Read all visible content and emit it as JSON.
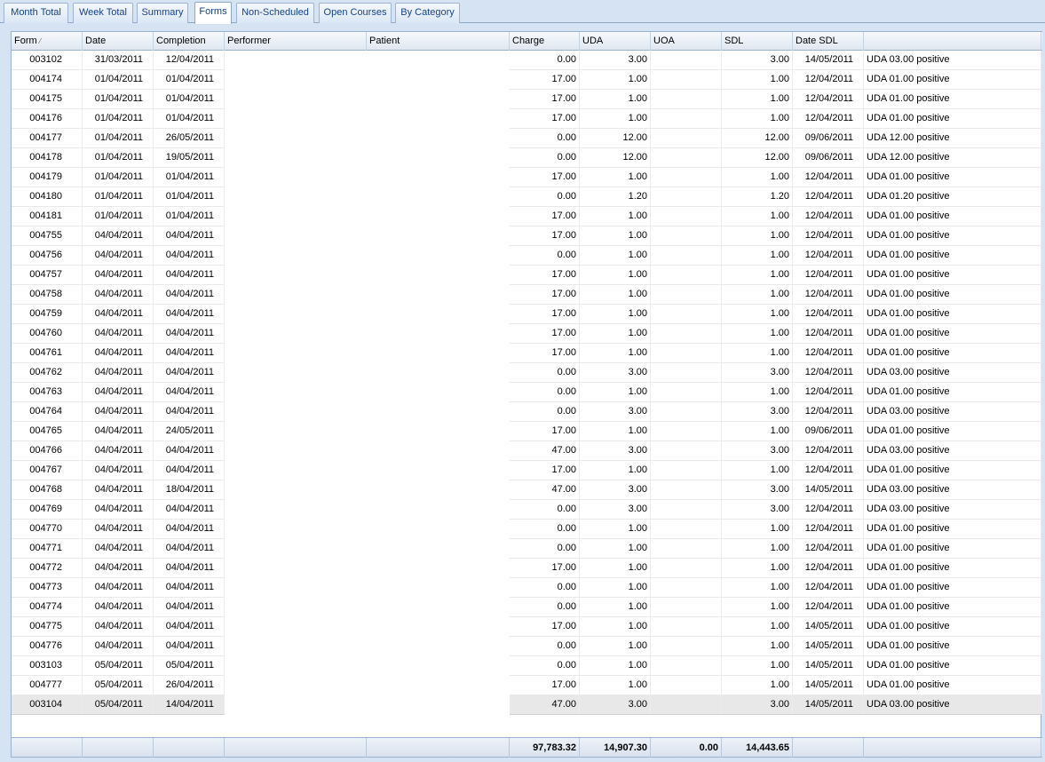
{
  "tabs": [
    {
      "label": "Month Total",
      "active": false
    },
    {
      "label": "Week Total",
      "active": false
    },
    {
      "label": "Summary",
      "active": false
    },
    {
      "label": "Forms",
      "active": true
    },
    {
      "label": "Non-Scheduled",
      "active": false
    },
    {
      "label": "Open Courses",
      "active": false
    },
    {
      "label": "By Category",
      "active": false
    }
  ],
  "columns": [
    "Form",
    "Date",
    "Completion",
    "Performer",
    "Patient",
    "Charge",
    "UDA",
    "UOA",
    "SDL",
    "Date SDL",
    ""
  ],
  "sort_indicator": "⁄",
  "rows": [
    [
      "003102",
      "31/03/2011",
      "12/04/2011",
      "",
      "",
      "0.00",
      "3.00",
      "",
      "3.00",
      "14/05/2011",
      "UDA 03.00 positive"
    ],
    [
      "004174",
      "01/04/2011",
      "01/04/2011",
      "",
      "",
      "17.00",
      "1.00",
      "",
      "1.00",
      "12/04/2011",
      "UDA 01.00 positive"
    ],
    [
      "004175",
      "01/04/2011",
      "01/04/2011",
      "",
      "",
      "17.00",
      "1.00",
      "",
      "1.00",
      "12/04/2011",
      "UDA 01.00 positive"
    ],
    [
      "004176",
      "01/04/2011",
      "01/04/2011",
      "",
      "",
      "17.00",
      "1.00",
      "",
      "1.00",
      "12/04/2011",
      "UDA 01.00 positive"
    ],
    [
      "004177",
      "01/04/2011",
      "26/05/2011",
      "",
      "",
      "0.00",
      "12.00",
      "",
      "12.00",
      "09/06/2011",
      "UDA 12.00 positive"
    ],
    [
      "004178",
      "01/04/2011",
      "19/05/2011",
      "",
      "",
      "0.00",
      "12.00",
      "",
      "12.00",
      "09/06/2011",
      "UDA 12.00 positive"
    ],
    [
      "004179",
      "01/04/2011",
      "01/04/2011",
      "",
      "",
      "17.00",
      "1.00",
      "",
      "1.00",
      "12/04/2011",
      "UDA 01.00 positive"
    ],
    [
      "004180",
      "01/04/2011",
      "01/04/2011",
      "",
      "",
      "0.00",
      "1.20",
      "",
      "1.20",
      "12/04/2011",
      "UDA 01.20 positive"
    ],
    [
      "004181",
      "01/04/2011",
      "01/04/2011",
      "",
      "",
      "17.00",
      "1.00",
      "",
      "1.00",
      "12/04/2011",
      "UDA 01.00 positive"
    ],
    [
      "004755",
      "04/04/2011",
      "04/04/2011",
      "",
      "",
      "17.00",
      "1.00",
      "",
      "1.00",
      "12/04/2011",
      "UDA 01.00 positive"
    ],
    [
      "004756",
      "04/04/2011",
      "04/04/2011",
      "",
      "",
      "0.00",
      "1.00",
      "",
      "1.00",
      "12/04/2011",
      "UDA 01.00 positive"
    ],
    [
      "004757",
      "04/04/2011",
      "04/04/2011",
      "",
      "",
      "17.00",
      "1.00",
      "",
      "1.00",
      "12/04/2011",
      "UDA 01.00 positive"
    ],
    [
      "004758",
      "04/04/2011",
      "04/04/2011",
      "",
      "",
      "17.00",
      "1.00",
      "",
      "1.00",
      "12/04/2011",
      "UDA 01.00 positive"
    ],
    [
      "004759",
      "04/04/2011",
      "04/04/2011",
      "",
      "",
      "17.00",
      "1.00",
      "",
      "1.00",
      "12/04/2011",
      "UDA 01.00 positive"
    ],
    [
      "004760",
      "04/04/2011",
      "04/04/2011",
      "",
      "",
      "17.00",
      "1.00",
      "",
      "1.00",
      "12/04/2011",
      "UDA 01.00 positive"
    ],
    [
      "004761",
      "04/04/2011",
      "04/04/2011",
      "",
      "",
      "17.00",
      "1.00",
      "",
      "1.00",
      "12/04/2011",
      "UDA 01.00 positive"
    ],
    [
      "004762",
      "04/04/2011",
      "04/04/2011",
      "",
      "",
      "0.00",
      "3.00",
      "",
      "3.00",
      "12/04/2011",
      "UDA 03.00 positive"
    ],
    [
      "004763",
      "04/04/2011",
      "04/04/2011",
      "",
      "",
      "0.00",
      "1.00",
      "",
      "1.00",
      "12/04/2011",
      "UDA 01.00 positive"
    ],
    [
      "004764",
      "04/04/2011",
      "04/04/2011",
      "",
      "",
      "0.00",
      "3.00",
      "",
      "3.00",
      "12/04/2011",
      "UDA 03.00 positive"
    ],
    [
      "004765",
      "04/04/2011",
      "24/05/2011",
      "",
      "",
      "17.00",
      "1.00",
      "",
      "1.00",
      "09/06/2011",
      "UDA 01.00 positive"
    ],
    [
      "004766",
      "04/04/2011",
      "04/04/2011",
      "",
      "",
      "47.00",
      "3.00",
      "",
      "3.00",
      "12/04/2011",
      "UDA 03.00 positive"
    ],
    [
      "004767",
      "04/04/2011",
      "04/04/2011",
      "",
      "",
      "17.00",
      "1.00",
      "",
      "1.00",
      "12/04/2011",
      "UDA 01.00 positive"
    ],
    [
      "004768",
      "04/04/2011",
      "18/04/2011",
      "",
      "",
      "47.00",
      "3.00",
      "",
      "3.00",
      "14/05/2011",
      "UDA 03.00 positive"
    ],
    [
      "004769",
      "04/04/2011",
      "04/04/2011",
      "",
      "",
      "0.00",
      "3.00",
      "",
      "3.00",
      "12/04/2011",
      "UDA 03.00 positive"
    ],
    [
      "004770",
      "04/04/2011",
      "04/04/2011",
      "",
      "",
      "0.00",
      "1.00",
      "",
      "1.00",
      "12/04/2011",
      "UDA 01.00 positive"
    ],
    [
      "004771",
      "04/04/2011",
      "04/04/2011",
      "",
      "",
      "0.00",
      "1.00",
      "",
      "1.00",
      "12/04/2011",
      "UDA 01.00 positive"
    ],
    [
      "004772",
      "04/04/2011",
      "04/04/2011",
      "",
      "",
      "17.00",
      "1.00",
      "",
      "1.00",
      "12/04/2011",
      "UDA 01.00 positive"
    ],
    [
      "004773",
      "04/04/2011",
      "04/04/2011",
      "",
      "",
      "0.00",
      "1.00",
      "",
      "1.00",
      "12/04/2011",
      "UDA 01.00 positive"
    ],
    [
      "004774",
      "04/04/2011",
      "04/04/2011",
      "",
      "",
      "0.00",
      "1.00",
      "",
      "1.00",
      "12/04/2011",
      "UDA 01.00 positive"
    ],
    [
      "004775",
      "04/04/2011",
      "04/04/2011",
      "",
      "",
      "17.00",
      "1.00",
      "",
      "1.00",
      "14/05/2011",
      "UDA 01.00 positive"
    ],
    [
      "004776",
      "04/04/2011",
      "04/04/2011",
      "",
      "",
      "0.00",
      "1.00",
      "",
      "1.00",
      "14/05/2011",
      "UDA 01.00 positive"
    ],
    [
      "003103",
      "05/04/2011",
      "05/04/2011",
      "",
      "",
      "0.00",
      "1.00",
      "",
      "1.00",
      "14/05/2011",
      "UDA 01.00 positive"
    ],
    [
      "004777",
      "05/04/2011",
      "26/04/2011",
      "",
      "",
      "17.00",
      "1.00",
      "",
      "1.00",
      "14/05/2011",
      "UDA 01.00 positive"
    ],
    [
      "003104",
      "05/04/2011",
      "14/04/2011",
      "",
      "",
      "47.00",
      "3.00",
      "",
      "3.00",
      "14/05/2011",
      "UDA 03.00 positive"
    ]
  ],
  "selected_row_index": 33,
  "totals": [
    "",
    "",
    "",
    "",
    "",
    "97,783.32",
    "14,907.30",
    "0.00",
    "14,443.65",
    "",
    ""
  ]
}
